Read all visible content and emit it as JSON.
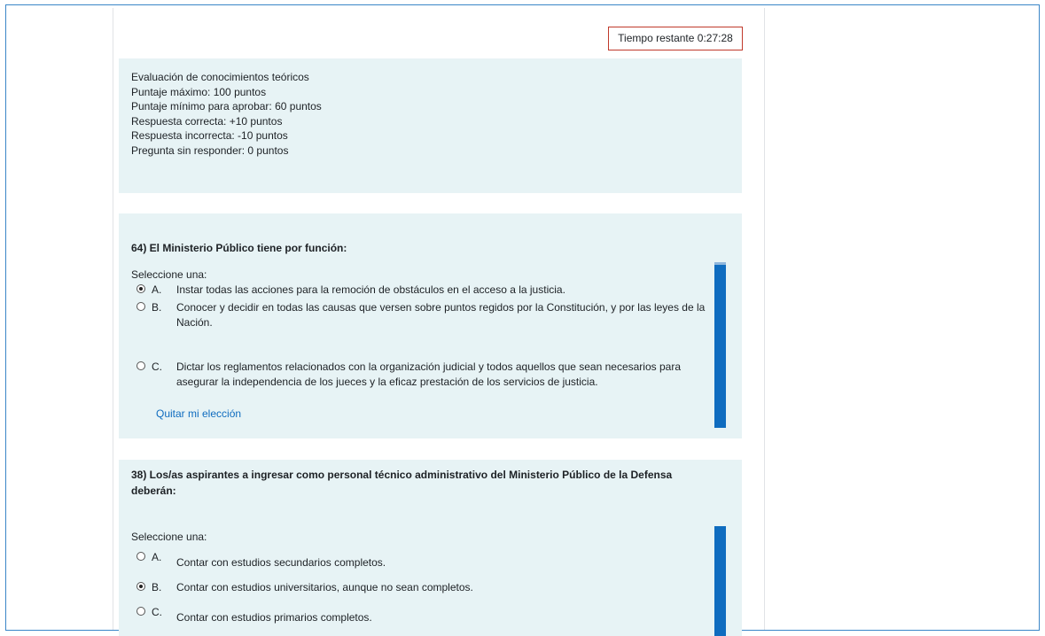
{
  "timer": {
    "label": "Tiempo restante",
    "value": "0:27:28"
  },
  "info": {
    "lines": [
      "Evaluación de conocimientos teóricos",
      "Puntaje máximo: 100 puntos",
      "Puntaje mínimo para aprobar: 60 puntos",
      "Respuesta correcta: +10 puntos",
      "Respuesta incorrecta: -10 puntos",
      "Pregunta sin responder: 0 puntos"
    ]
  },
  "questions": [
    {
      "text": "64) El Ministerio Público tiene por función:",
      "prompt": "Seleccione una:",
      "options": [
        {
          "letter": "A.",
          "text": "Instar todas las acciones para la remoción de obstáculos en el acceso a la justicia.",
          "selected": true
        },
        {
          "letter": "B.",
          "text": "Conocer y decidir en todas las causas que versen sobre puntos regidos por la Constitución, y por las leyes de la Nación.",
          "selected": false
        },
        {
          "letter": "C.",
          "text": "Dictar los reglamentos relacionados con la organización judicial y todos aquellos que sean necesarios para asegurar la independencia de los jueces y la eficaz prestación de los servicios de justicia.",
          "selected": false
        }
      ],
      "clear_label": "Quitar mi elección"
    },
    {
      "text": "38) Los/as aspirantes a ingresar como personal técnico administrativo del Ministerio Público de la Defensa deberán:",
      "prompt": "Seleccione una:",
      "options": [
        {
          "letter": "A.",
          "text": "Contar con estudios secundarios completos.",
          "selected": false
        },
        {
          "letter": "B.",
          "text": "Contar con estudios universitarios, aunque no sean completos.",
          "selected": true
        },
        {
          "letter": "C.",
          "text": "Contar con estudios primarios completos.",
          "selected": false
        }
      ]
    }
  ],
  "colors": {
    "accent": "#0f6cbf",
    "panel_bg": "#e7f3f5",
    "timer_border": "#c0392b",
    "frame_border": "#3a86c8"
  }
}
